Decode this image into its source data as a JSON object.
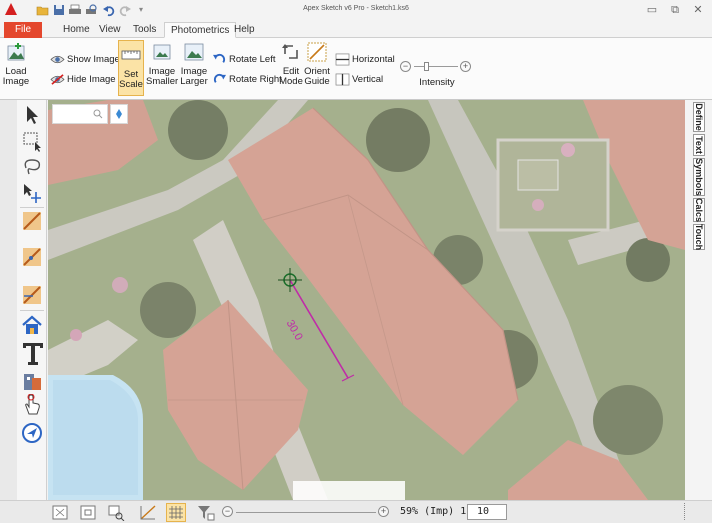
{
  "window": {
    "title": "Apex Sketch v6 Pro - Sketch1.ks6",
    "minimize": "▭",
    "restore": "⧉",
    "close": "✕"
  },
  "quick_access": [
    "open-icon",
    "save-icon",
    "print-icon",
    "print-preview-icon",
    "undo-icon",
    "redo-icon",
    "dropdown-icon"
  ],
  "tabs": [
    {
      "label": "File",
      "active": false
    },
    {
      "label": "Home",
      "active": false
    },
    {
      "label": "View",
      "active": false
    },
    {
      "label": "Tools",
      "active": false
    },
    {
      "label": "Photometrics",
      "active": true
    },
    {
      "label": "Help",
      "active": false
    }
  ],
  "ribbon": {
    "load_image": {
      "line1": "Load",
      "line2": "Image"
    },
    "show_image": "Show Image",
    "hide_image": "Hide Image",
    "set_scale": {
      "line1": "Set",
      "line2": "Scale"
    },
    "image_smaller": {
      "line1": "Image",
      "line2": "Smaller"
    },
    "image_larger": {
      "line1": "Image",
      "line2": "Larger"
    },
    "rotate_left": "Rotate Left",
    "rotate_right": "Rotate Right",
    "edit_mode": {
      "line1": "Edit",
      "line2": "Mode"
    },
    "orient_guide": {
      "line1": "Orient",
      "line2": "Guide"
    },
    "horizontal": "Horizontal",
    "vertical": "Vertical",
    "intensity": "Intensity"
  },
  "left_tools": [
    "select-arrow-icon",
    "rectangle-select-icon",
    "lasso-icon",
    "move-icon",
    "draw-segment-icon",
    "draw-polygon-icon",
    "draw-area-icon",
    "house-icon",
    "text-icon",
    "symbol-icon",
    "touch-icon",
    "navigate-icon"
  ],
  "map": {
    "measurement_label": "30.0",
    "measurement_color": "#c02aa8"
  },
  "right_tabs": [
    "Define",
    "Text",
    "Symbols",
    "Calcs",
    "Touch"
  ],
  "statusbar": {
    "zoom_text": "59% (Imp) 1:",
    "scale_value": "10",
    "tools": [
      "zoom-fit-icon",
      "zoom-extent-icon",
      "zoom-window-icon",
      "grid-snap-icon",
      "grid-icon",
      "filter-icon"
    ]
  },
  "colors": {
    "file_tab": "#e4472d",
    "active_tool": "#fbe3a6",
    "roof": "#c98a78"
  }
}
